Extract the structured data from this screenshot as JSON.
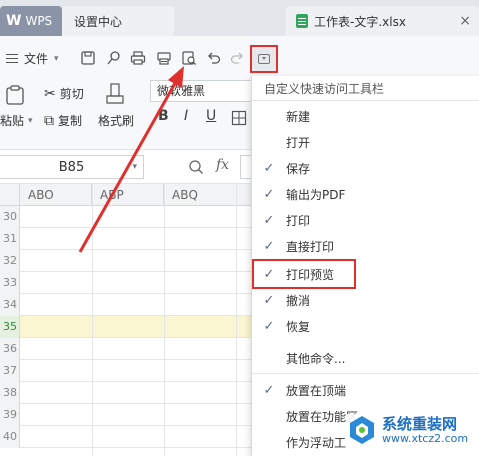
{
  "tabs": {
    "wps_label": "WPS",
    "settings_label": "设置中心",
    "document_label": "工作表-文字.xlsx",
    "close_glyph": "×"
  },
  "toolbar": {
    "file_menu_label": "文件",
    "icons": [
      "save-icon",
      "find-icon",
      "print-icon",
      "direct-print-icon",
      "print-preview-icon",
      "undo-icon",
      "redo-icon"
    ]
  },
  "ribbon": {
    "cut_label": "剪切",
    "paste_label": "粘贴",
    "copy_label": "复制",
    "format_painter_label": "格式刷",
    "font_name": "微软雅黑",
    "bold": "B",
    "italic": "I",
    "underline": "U"
  },
  "formula": {
    "cell_ref": "B85",
    "fx_label": "fx"
  },
  "grid": {
    "columns": [
      "ABO",
      "ABP",
      "ABQ"
    ],
    "rows": [
      "30",
      "31",
      "32",
      "33",
      "34",
      "35",
      "36",
      "37",
      "38",
      "39",
      "40"
    ],
    "selected_row": "35"
  },
  "quick_access_menu": {
    "title": "自定义快速访问工具栏",
    "items": [
      {
        "label": "新建",
        "checked": false
      },
      {
        "label": "打开",
        "checked": false
      },
      {
        "label": "保存",
        "checked": true
      },
      {
        "label": "输出为PDF",
        "checked": true
      },
      {
        "label": "打印",
        "checked": true
      },
      {
        "label": "直接打印",
        "checked": true
      },
      {
        "label": "打印预览",
        "checked": true
      },
      {
        "label": "撤消",
        "checked": true
      },
      {
        "label": "恢复",
        "checked": true
      },
      {
        "label": "其他命令...",
        "checked": false
      },
      {
        "label": "放置在顶端",
        "checked": true
      },
      {
        "label": "放置在功能区",
        "checked": false
      },
      {
        "label": "作为浮动工",
        "checked": false
      }
    ],
    "highlighted_item": "打印预览"
  },
  "colors": {
    "accent_red": "#e0302d",
    "selected_row": "#faf6d2",
    "check_color": "#5b6b84"
  },
  "watermark": {
    "name": "系统重装网",
    "url": "www.xtcz2.com"
  }
}
